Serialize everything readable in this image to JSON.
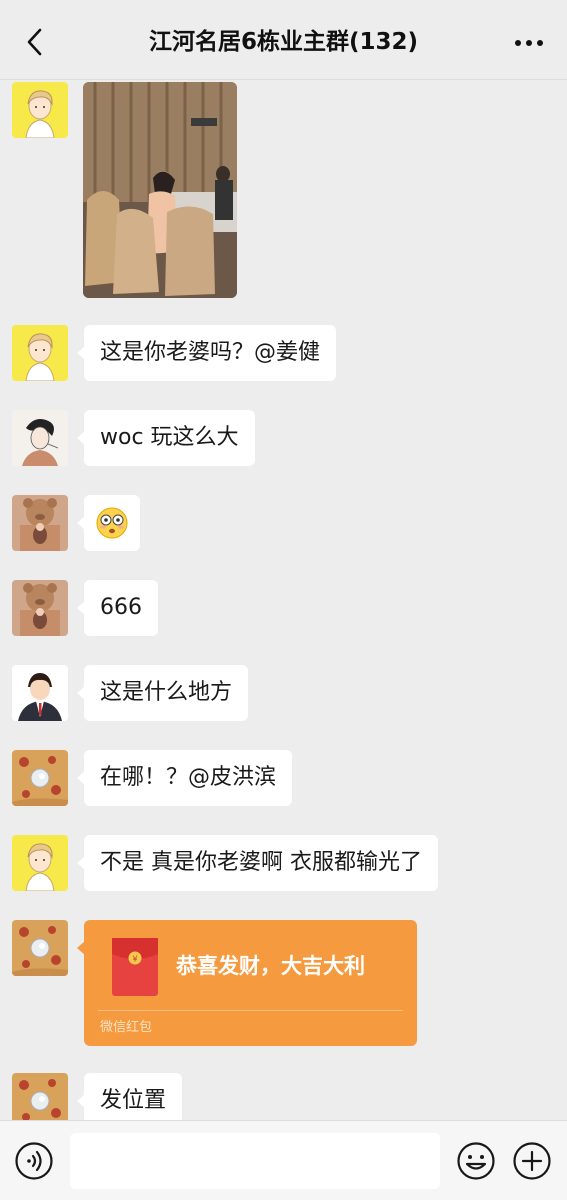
{
  "header": {
    "title": "江河名居6栋业主群(132)",
    "back_icon": "chevron-left-icon",
    "more_icon": "more-dots-icon"
  },
  "messages": [
    {
      "type": "image",
      "avatar": "yellow-cartoon-boy",
      "image": "photo-room-chairs"
    },
    {
      "type": "text",
      "avatar": "yellow-cartoon-boy",
      "text": "这是你老婆吗？@姜健"
    },
    {
      "type": "text",
      "avatar": "ink-sketch-man",
      "text": "woc 玩这么大"
    },
    {
      "type": "emoji",
      "avatar": "teddy-bear-photo",
      "emoji": "😳"
    },
    {
      "type": "text",
      "avatar": "teddy-bear-photo",
      "text": "666"
    },
    {
      "type": "text",
      "avatar": "suited-cartoon-man",
      "text": "这是什么地方"
    },
    {
      "type": "text",
      "avatar": "pizza-photo",
      "text": "在哪！？@皮洪滨"
    },
    {
      "type": "text",
      "avatar": "yellow-cartoon-boy",
      "text": "不是 真是你老婆啊 衣服都输光了"
    },
    {
      "type": "red_packet",
      "avatar": "pizza-photo",
      "title": "恭喜发财，大吉大利",
      "footer": "微信红包",
      "color": "#f59a3f"
    },
    {
      "type": "text",
      "avatar": "pizza-photo",
      "text": "发位置"
    }
  ],
  "input_bar": {
    "voice_icon": "voice-icon",
    "input_value": "",
    "emoji_icon": "emoji-icon",
    "plus_icon": "plus-icon"
  },
  "colors": {
    "background": "#ededed",
    "bubble": "#ffffff",
    "red_packet": "#f59a3f"
  }
}
